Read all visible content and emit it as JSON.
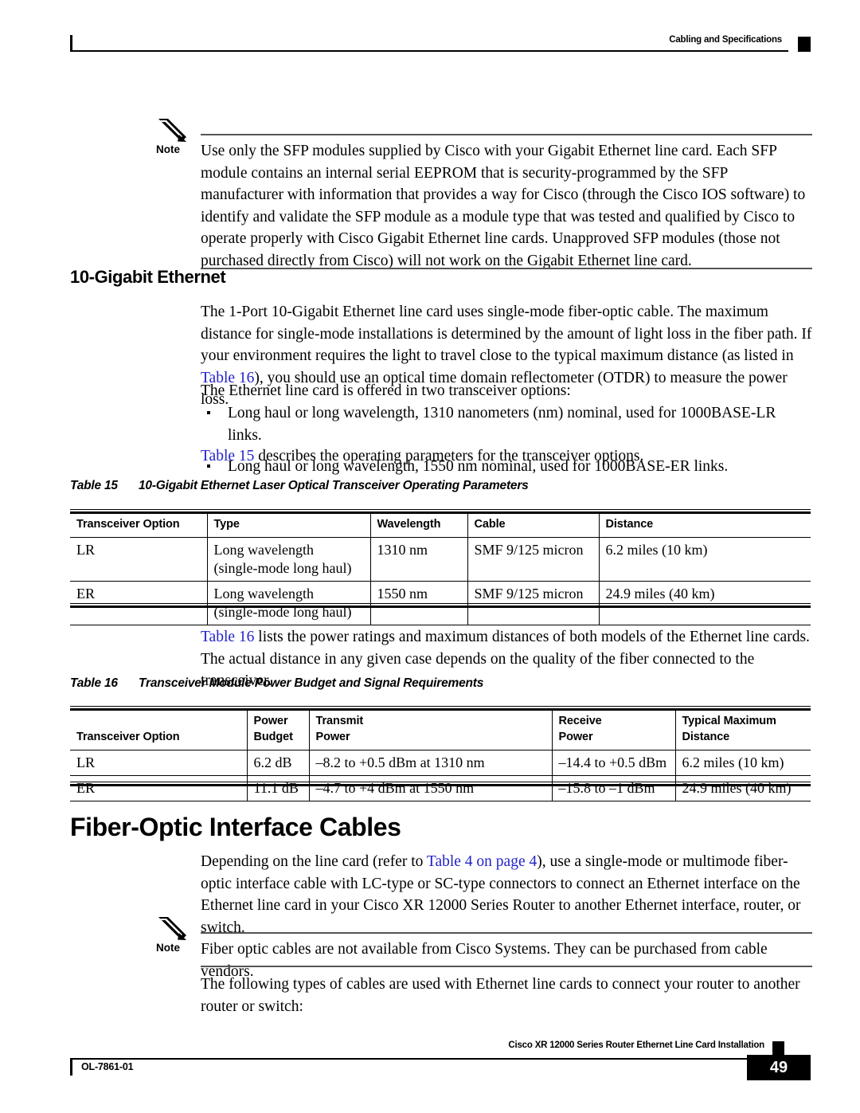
{
  "header": {
    "title": "Cabling and Specifications"
  },
  "note1": {
    "label": "Note",
    "icon": "pencil-icon",
    "text": "Use only the SFP modules supplied by Cisco with your Gigabit Ethernet line card. Each SFP module contains an internal serial EEPROM that is security-programmed by the SFP manufacturer with information that provides a way for Cisco (through the Cisco IOS software) to identify and validate the SFP module as a module type that was tested and qualified by Cisco to operate properly with Cisco Gigabit Ethernet line cards. Unapproved SFP modules (those not purchased directly from Cisco) will not work on the Gigabit Ethernet line card."
  },
  "section_10gig": {
    "heading": "10-Gigabit Ethernet",
    "para1_a": "The 1-Port 10-Gigabit Ethernet line card uses single-mode fiber-optic cable. The maximum distance for single-mode installations is determined by the amount of light loss in the fiber path. If your environment requires the light to travel close to the typical maximum distance (as listed in ",
    "para1_link": "Table 16",
    "para1_b": "), you should use an optical time domain reflectometer (OTDR) to measure the power loss.",
    "para2": "The Ethernet line card is offered in two transceiver options:",
    "bullets": [
      "Long haul or long wavelength, 1310 nanometers (nm) nominal, used for 1000BASE-LR links.",
      "Long haul or long wavelength, 1550 nm nominal, used for 1000BASE-ER links."
    ],
    "para3_link": "Table 15",
    "para3_b": " describes the operating parameters for the transceiver options."
  },
  "table15": {
    "caption_num": "Table 15",
    "caption_title": "10-Gigabit Ethernet Laser Optical Transceiver Operating Parameters",
    "columns": [
      "Transceiver Option",
      "Type",
      "Wavelength",
      "Cable",
      "Distance"
    ],
    "rows": [
      {
        "option": "LR",
        "type": "Long wavelength\n(single-mode long haul)",
        "wavelength": "1310 nm",
        "cable": "SMF 9/125 micron",
        "distance": "6.2 miles (10 km)"
      },
      {
        "option": "ER",
        "type": "Long wavelength\n(single-mode long haul)",
        "wavelength": "1550 nm",
        "cable": "SMF 9/125 micron",
        "distance": "24.9 miles (40 km)"
      }
    ]
  },
  "table16_intro": {
    "link": "Table 16",
    "text": " lists the power ratings and maximum distances of both models of the Ethernet line cards. The actual distance in any given case depends on the quality of the fiber connected to the transceiver."
  },
  "table16": {
    "caption_num": "Table 16",
    "caption_title": "Transceiver Module Power Budget and Signal Requirements",
    "columns": [
      "Transceiver Option",
      "Power\nBudget",
      "Transmit\nPower",
      "Receive\nPower",
      "Typical Maximum Distance"
    ],
    "rows": [
      {
        "option": "LR",
        "power_budget": "6.2 dB",
        "transmit_power": "–8.2 to +0.5 dBm at 1310 nm",
        "receive_power": "–14.4 to +0.5 dBm",
        "typical_max_distance": "6.2 miles (10 km)"
      },
      {
        "option": "ER",
        "power_budget": "11.1 dB",
        "transmit_power": "–4.7 to +4 dBm at 1550 nm",
        "receive_power": "–15.8 to –1 dBm",
        "typical_max_distance": "24.9 miles (40 km)"
      }
    ]
  },
  "section_fiber": {
    "heading": "Fiber-Optic Interface Cables",
    "para1_a": "Depending on the line card (refer to ",
    "para1_link": "Table 4 on page 4",
    "para1_b": "), use a single-mode or multimode fiber-optic interface cable with LC-type or SC-type connectors to connect an Ethernet interface on the Ethernet line card in your Cisco XR 12000 Series Router to another Ethernet interface, router, or switch.",
    "para2": "The following types of cables are used with Ethernet line cards to connect your router to another router or switch:"
  },
  "note2": {
    "label": "Note",
    "icon": "pencil-icon",
    "text": "Fiber optic cables are not available from Cisco Systems. They can be purchased from cable vendors."
  },
  "footer": {
    "title": "Cisco XR 12000 Series Router Ethernet Line Card Installation",
    "doc_id": "OL-7861-01",
    "page_number": "49"
  }
}
